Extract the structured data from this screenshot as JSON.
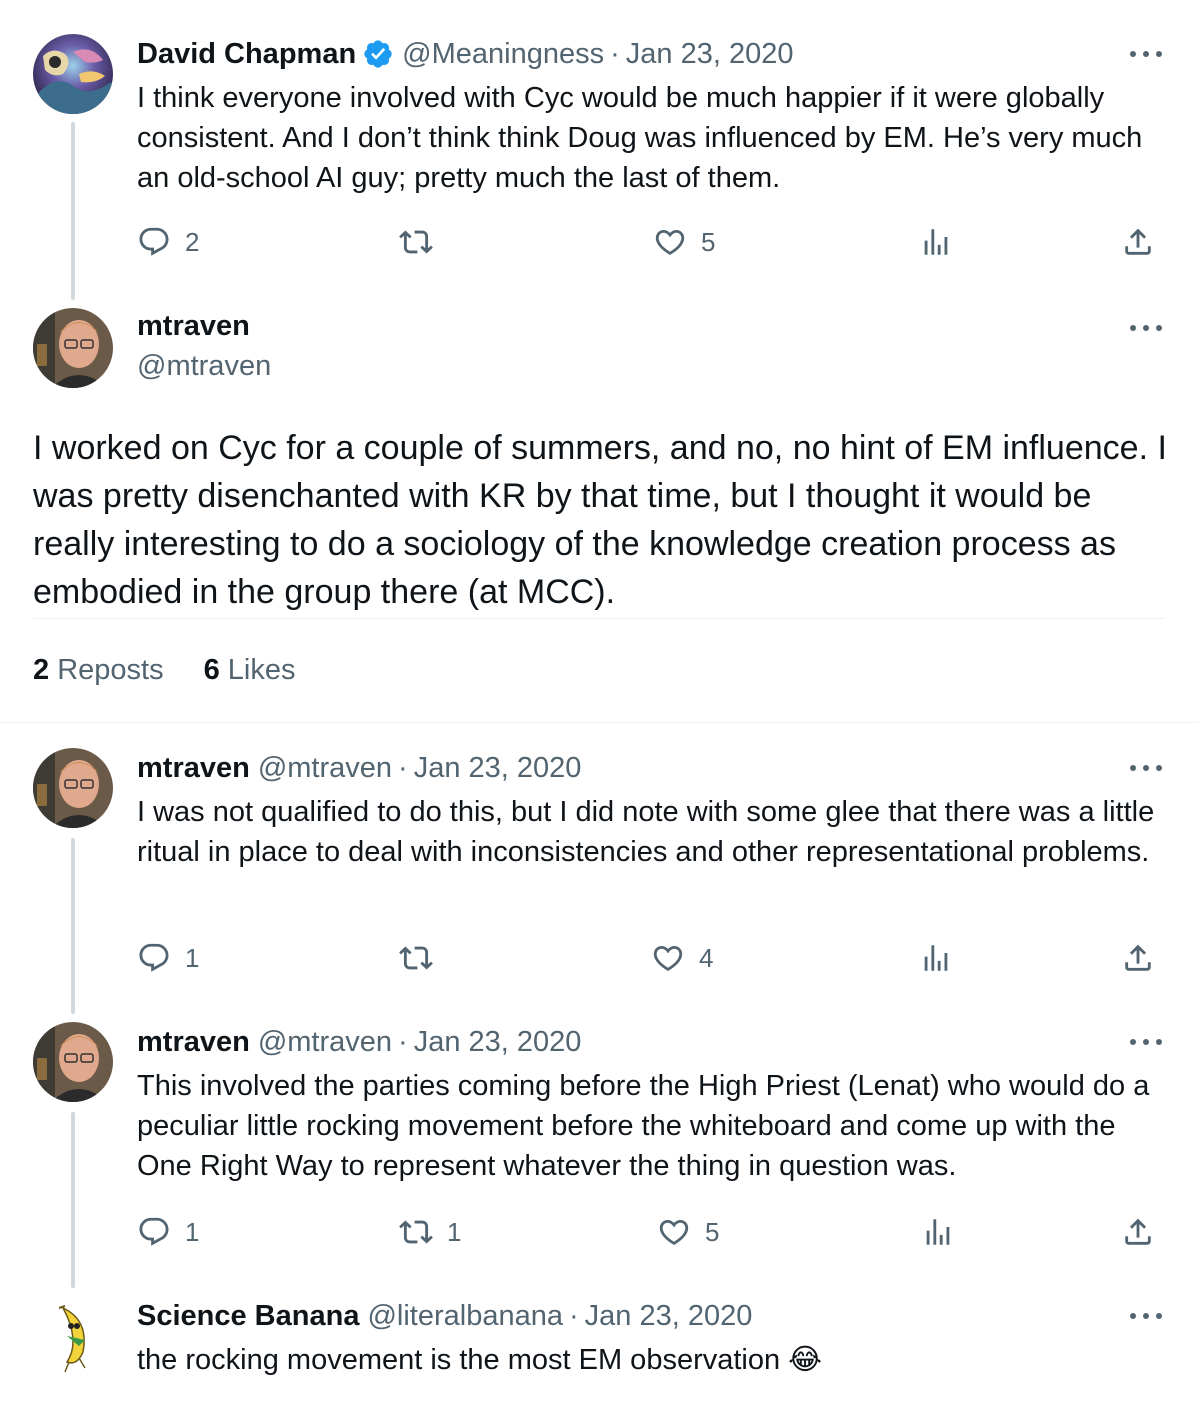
{
  "tweets": [
    {
      "name": "David Chapman",
      "handle": "@Meaningness",
      "sep": "·",
      "date": "Jan 23, 2020",
      "text": "I think everyone involved with Cyc would be much happier if it were globally consistent. And I don’t think think Doug was influenced by EM. He’s very much an old-school AI guy; pretty much the last of them.",
      "replies": "2",
      "reposts": "",
      "likes": "5"
    },
    {
      "name": "mtraven",
      "handle": "@mtraven",
      "sep": "·",
      "date": "Jan 23, 2020",
      "text": "I was not qualified to do this, but I did note with some glee that there was a little ritual in place to deal with inconsistencies and other representational problems.",
      "replies": "1",
      "reposts": "",
      "likes": "4"
    },
    {
      "name": "mtraven",
      "handle": "@mtraven",
      "sep": "·",
      "date": "Jan 23, 2020",
      "text": "This involved the parties coming before the High Priest (Lenat) who would do a peculiar little rocking movement before the whiteboard and come up with the One Right Way to represent whatever the thing in question was.",
      "replies": "1",
      "reposts": "1",
      "likes": "5"
    },
    {
      "name": "Science Banana",
      "handle": "@literalbanana",
      "sep": "·",
      "date": "Jan 23, 2020",
      "text": "the rocking movement is the most EM observation 😂"
    }
  ],
  "main": {
    "name": "mtraven",
    "handle": "@mtraven",
    "text": "I worked on Cyc for a couple of summers, and no, no hint of EM influence. I was pretty disenchanted with KR by that time, but I thought it would be really interesting to do a sociology of the knowledge creation process as embodied in the group there (at MCC).",
    "reposts_count": "2",
    "reposts_label": "Reposts",
    "likes_count": "6",
    "likes_label": "Likes"
  },
  "icons": {
    "reply": "reply-icon",
    "repost": "repost-icon",
    "like": "heart-icon",
    "views": "views-icon",
    "share": "share-icon",
    "more": "more-icon",
    "verified": "verified-badge-icon"
  },
  "colors": {
    "text": "#0f1419",
    "secondary": "#536471",
    "verified": "#1d9bf0",
    "thread_line": "#cfd9de",
    "divider": "#eff3f4"
  }
}
